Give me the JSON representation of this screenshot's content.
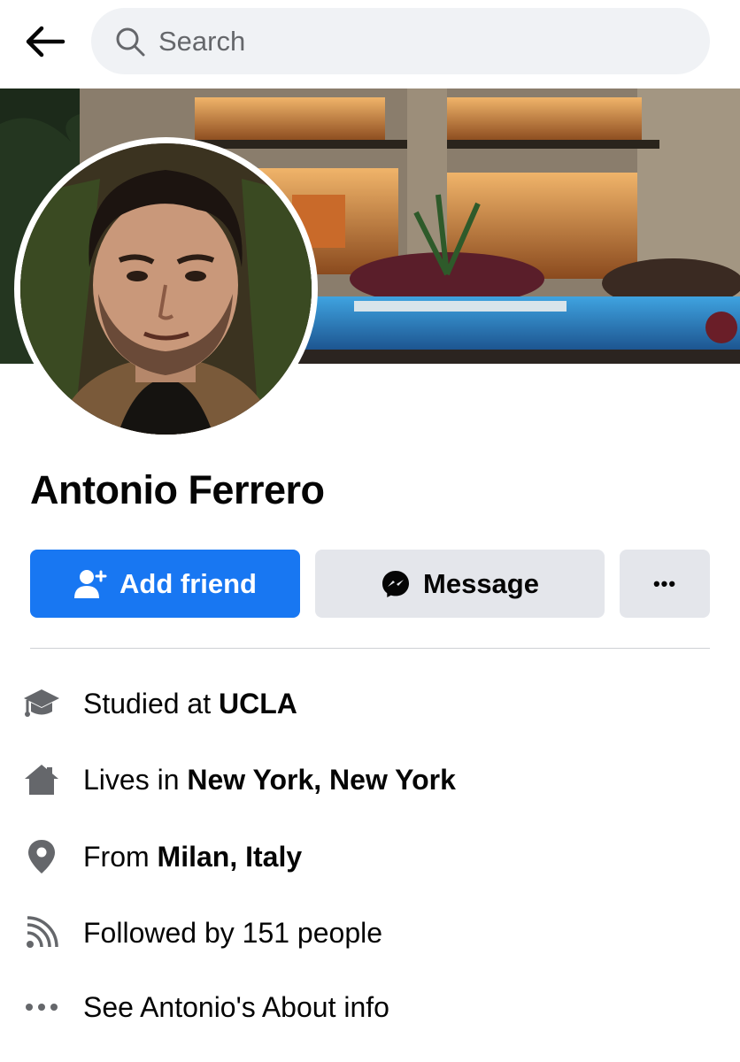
{
  "search": {
    "placeholder": "Search"
  },
  "profile": {
    "name": "Antonio Ferrero"
  },
  "actions": {
    "add_friend_label": "Add friend",
    "message_label": "Message",
    "more_label": "•••"
  },
  "info": {
    "education": {
      "prefix": "Studied at ",
      "value": "UCLA"
    },
    "residence": {
      "prefix": "Lives in ",
      "value": "New York, New York"
    },
    "hometown": {
      "prefix": "From ",
      "value": "Milan, Italy"
    },
    "followers": {
      "text": "Followed by 151 people"
    },
    "about": {
      "text": "See Antonio's About info"
    }
  },
  "colors": {
    "accent": "#1877f2",
    "secondary_button": "#e4e6eb",
    "icon_gray": "#65676b"
  }
}
